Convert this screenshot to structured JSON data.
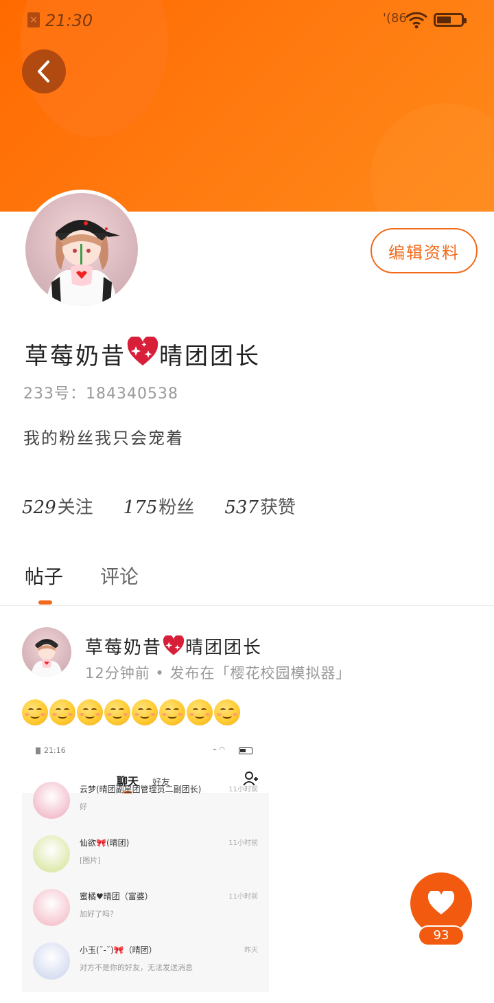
{
  "status_bar": {
    "time": "21:30",
    "signal_text": "'(86"
  },
  "profile": {
    "name_part1": "草莓奶昔",
    "name_part2": "晴团团长",
    "uid_label": "233号：",
    "uid_value": "184340538",
    "bio": "我的粉丝我只会宠着",
    "edit_button_label": "编辑资料",
    "stats": [
      {
        "value": "529",
        "label": "关注"
      },
      {
        "value": "175",
        "label": "粉丝"
      },
      {
        "value": "537",
        "label": "获赞"
      }
    ]
  },
  "tabs": [
    {
      "label": "帖子",
      "active": true
    },
    {
      "label": "评论",
      "active": false
    }
  ],
  "post": {
    "author_part1": "草莓奶昔",
    "author_part2": "晴团团长",
    "meta": "12分钟前 • 发布在「樱花校园模拟器」",
    "emoji_count": 8,
    "image": {
      "time": "21:16",
      "tab_chat": "聊天",
      "tab_friends": "好友",
      "rows": [
        {
          "name": "云梦(晴团副星团管理员二副团长)",
          "msg": "好",
          "time": "11小时前",
          "avatar_color": "#f3c2cf"
        },
        {
          "name": "仙欲🎀(晴团)",
          "msg": "[图片]",
          "time": "11小时前",
          "avatar_color": "#dfeab0"
        },
        {
          "name": "蜜橘♥晴团（富婆）",
          "msg": "加好了吗？",
          "time": "11小时前",
          "avatar_color": "#f6c9d2"
        },
        {
          "name": "小玉(˘-˘)🎀（晴团）",
          "msg": "对方不是你的好友，无法发送消息",
          "time": "昨天",
          "avatar_color": "#d9dff2"
        }
      ]
    }
  },
  "like": {
    "count": "93"
  },
  "colors": {
    "accent": "#f26a1b",
    "header_gradient_start": "#ff6a00",
    "header_gradient_end": "#ff8a1a",
    "like_button": "#f25a0f"
  }
}
